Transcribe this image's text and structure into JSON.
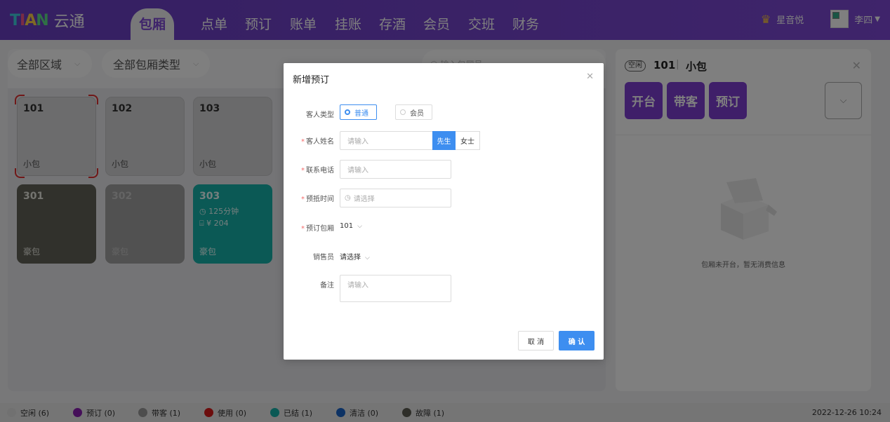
{
  "app": {
    "logo_mark": "TIAN",
    "logo_text": "云通"
  },
  "nav": {
    "active": "包厢",
    "items": [
      "点单",
      "预订",
      "账单",
      "挂账",
      "存酒",
      "会员",
      "交班",
      "财务"
    ]
  },
  "user": {
    "store": "星音悦",
    "name": "李四"
  },
  "filters": {
    "area": "全部区域",
    "room_type": "全部包厢类型",
    "search_placeholder": "输入包厢号"
  },
  "rooms": [
    {
      "num": "101",
      "type": "小包",
      "state": "selected"
    },
    {
      "num": "102",
      "type": "小包",
      "state": "idle"
    },
    {
      "num": "103",
      "type": "小包",
      "state": "idle"
    },
    {
      "num": "301",
      "type": "豪包",
      "state": "fault"
    },
    {
      "num": "302",
      "type": "豪包",
      "state": "guest"
    },
    {
      "num": "303",
      "type": "豪包",
      "state": "closed",
      "duration": "125分钟",
      "amount": "¥ 204"
    }
  ],
  "panel": {
    "status": "空闲",
    "room_num": "101",
    "sep": "|",
    "room_type": "小包",
    "actions": [
      "开台",
      "带客",
      "预订"
    ],
    "empty_text": "包厢未开台，暂无消费信息"
  },
  "modal": {
    "title": "新增预订",
    "customer_type_label": "客人类型",
    "customer_types": [
      "普通",
      "会员"
    ],
    "name_label": "客人姓名",
    "name_placeholder": "请输入",
    "gender": [
      "先生",
      "女士"
    ],
    "phone_label": "联系电话",
    "phone_placeholder": "请输入",
    "time_label": "预抵时间",
    "time_placeholder": "请选择",
    "room_label": "预订包厢",
    "room_value": "101",
    "sales_label": "销售员",
    "sales_value": "请选择",
    "note_label": "备注",
    "note_placeholder": "请输入",
    "cancel": "取 消",
    "ok": "确 认"
  },
  "legend": [
    {
      "label": "空闲 (6)",
      "color": "#e2e2e2"
    },
    {
      "label": "预订 (0)",
      "color": "#8a1fb3"
    },
    {
      "label": "带客 (1)",
      "color": "#9a9a9a"
    },
    {
      "label": "使用 (0)",
      "color": "#d81b1b"
    },
    {
      "label": "已结 (1)",
      "color": "#16b2aa"
    },
    {
      "label": "清洁 (0)",
      "color": "#1a64c8"
    },
    {
      "label": "故障 (1)",
      "color": "#5c5c52"
    }
  ],
  "datetime": "2022-12-26 10:24",
  "colors": {
    "brand": "#7e49d6",
    "primary_blue": "#3d8ef0",
    "action_purple": "#7e3ed3"
  }
}
